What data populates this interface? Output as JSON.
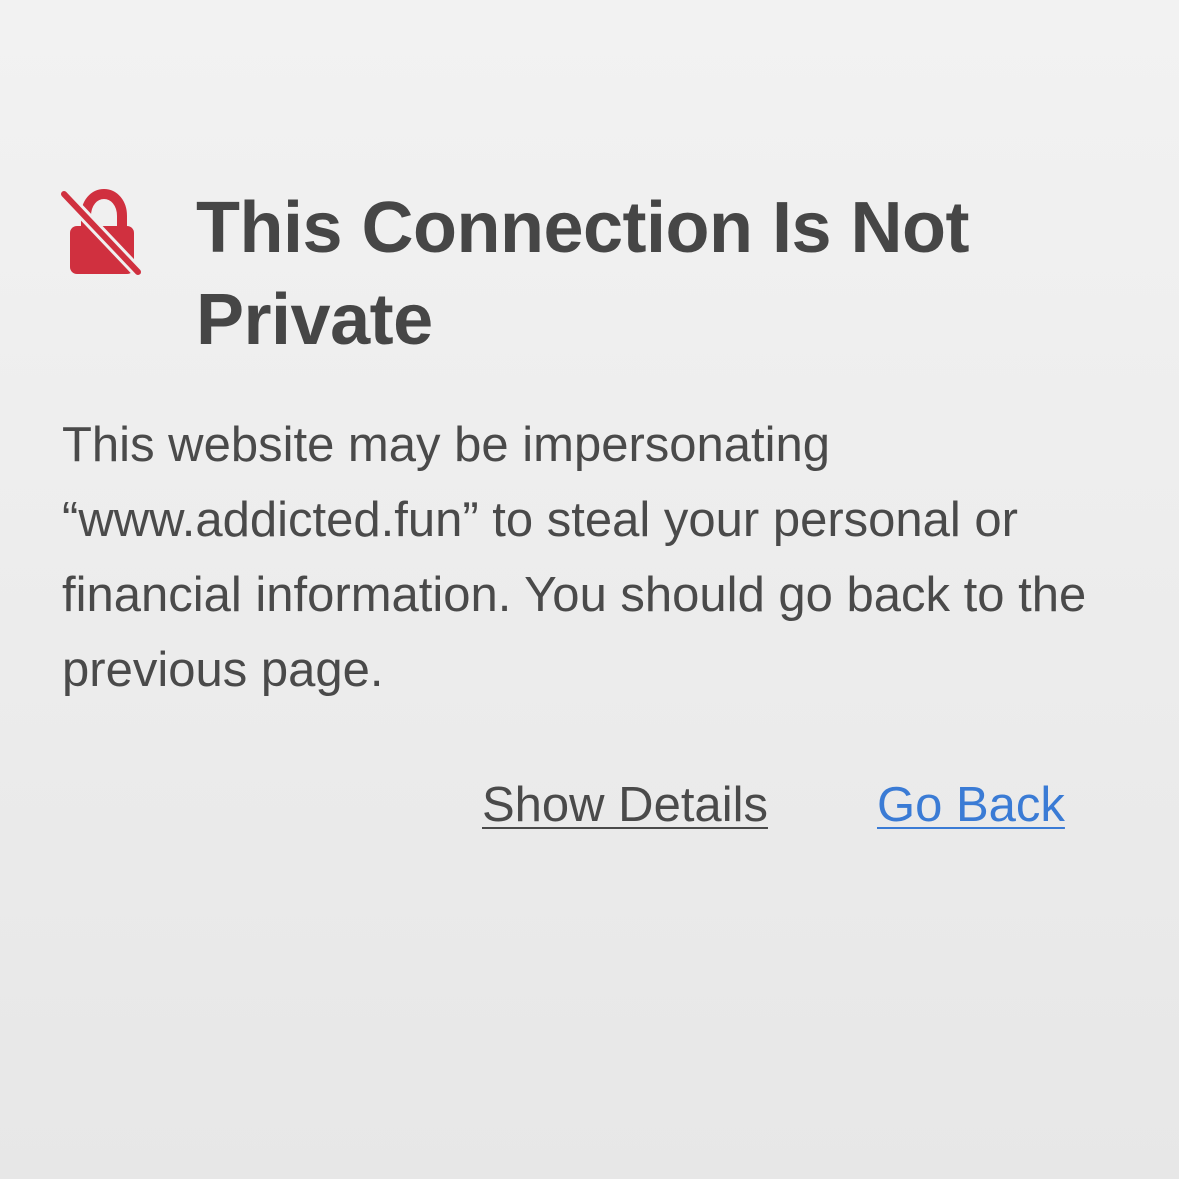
{
  "warning": {
    "icon": "lock-slash-icon",
    "icon_color": "#d0303f",
    "title": "This Connection Is Not Private",
    "message": "This website may be impersonating “www.addicted.fun” to steal your personal or financial information. You should go back to the previous page."
  },
  "actions": {
    "show_details_label": "Show Details",
    "go_back_label": "Go Back",
    "link_color": "#3a7bd5"
  }
}
